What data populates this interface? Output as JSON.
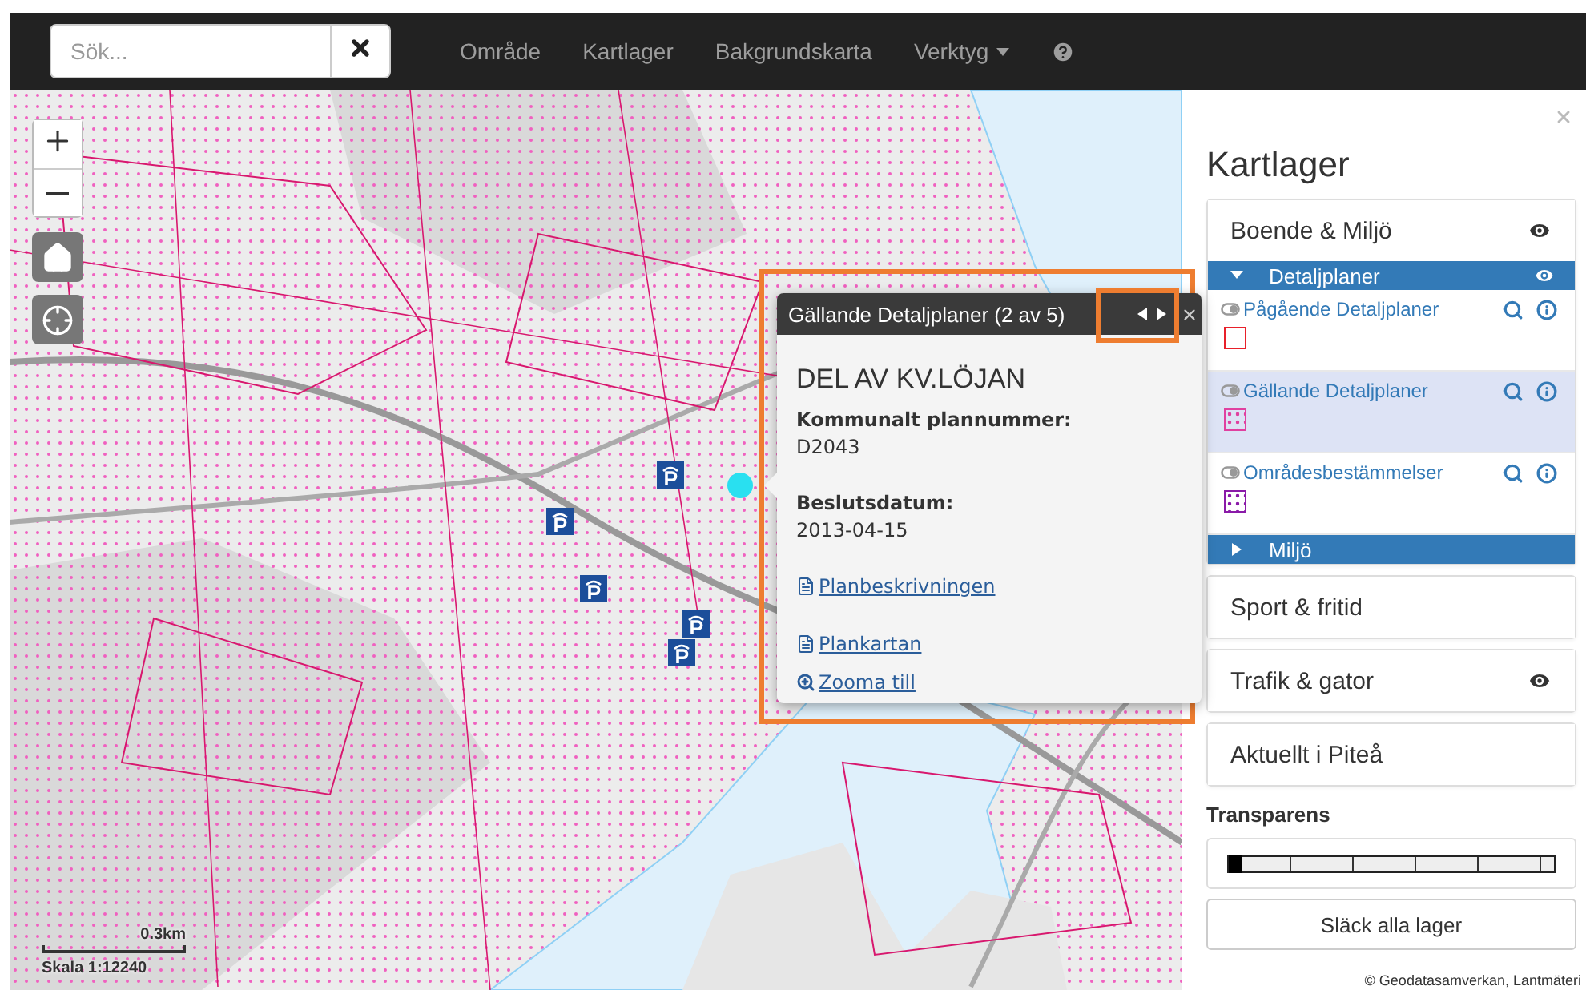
{
  "search": {
    "placeholder": "Sök..."
  },
  "nav": [
    {
      "kind": "link",
      "label": "Område"
    },
    {
      "kind": "link",
      "label": "Kartlager"
    },
    {
      "kind": "link",
      "label": "Bakgrundskarta"
    },
    {
      "kind": "dropdown",
      "label": "Verktyg"
    },
    {
      "kind": "help"
    }
  ],
  "map": {
    "scale_distance": "0.3km",
    "scale_label": "Skala 1:12240",
    "attribution": "© Geodatasamverkan, Lantmäteri"
  },
  "popup": {
    "title": "Gällande Detaljplaner (2 av 5)",
    "heading": "DEL AV KV.LÖJAN",
    "fields": [
      {
        "label": "Kommunalt plannummer:",
        "value": "D2043"
      },
      {
        "label": "Beslutsdatum:",
        "value": "2013-04-15"
      }
    ],
    "links": [
      {
        "kind": "document",
        "label": "Planbeskrivningen"
      },
      {
        "kind": "document",
        "label": "Plankartan"
      },
      {
        "kind": "zoom",
        "label": "Zooma till"
      }
    ]
  },
  "panel": {
    "title": "Kartlager",
    "groups": [
      {
        "label": "Boende & Miljö",
        "visible": true,
        "expanded": true,
        "children": [
          {
            "label": "Detaljplaner",
            "visible": true,
            "expanded": true,
            "children": [
              {
                "label": "Pågående Detaljplaner",
                "selected": false,
                "kind": "outline",
                "color": "#e8202a"
              },
              {
                "label": "Gällande Detaljplaner",
                "selected": true,
                "kind": "dotted",
                "color": "#e040a0"
              },
              {
                "label": "Områdesbestämmelser",
                "selected": false,
                "kind": "dotted",
                "color": "#8a1aa8"
              }
            ]
          },
          {
            "label": "Miljö",
            "visible": false,
            "expanded": false
          }
        ]
      },
      {
        "label": "Sport & fritid",
        "visible": false,
        "expanded": false
      },
      {
        "label": "Trafik & gator",
        "visible": true,
        "expanded": false
      },
      {
        "label": "Aktuellt i Piteå",
        "visible": false,
        "expanded": false
      }
    ],
    "transparency": {
      "label": "Transparens",
      "level": 0
    },
    "button": "Släck alla lager"
  }
}
